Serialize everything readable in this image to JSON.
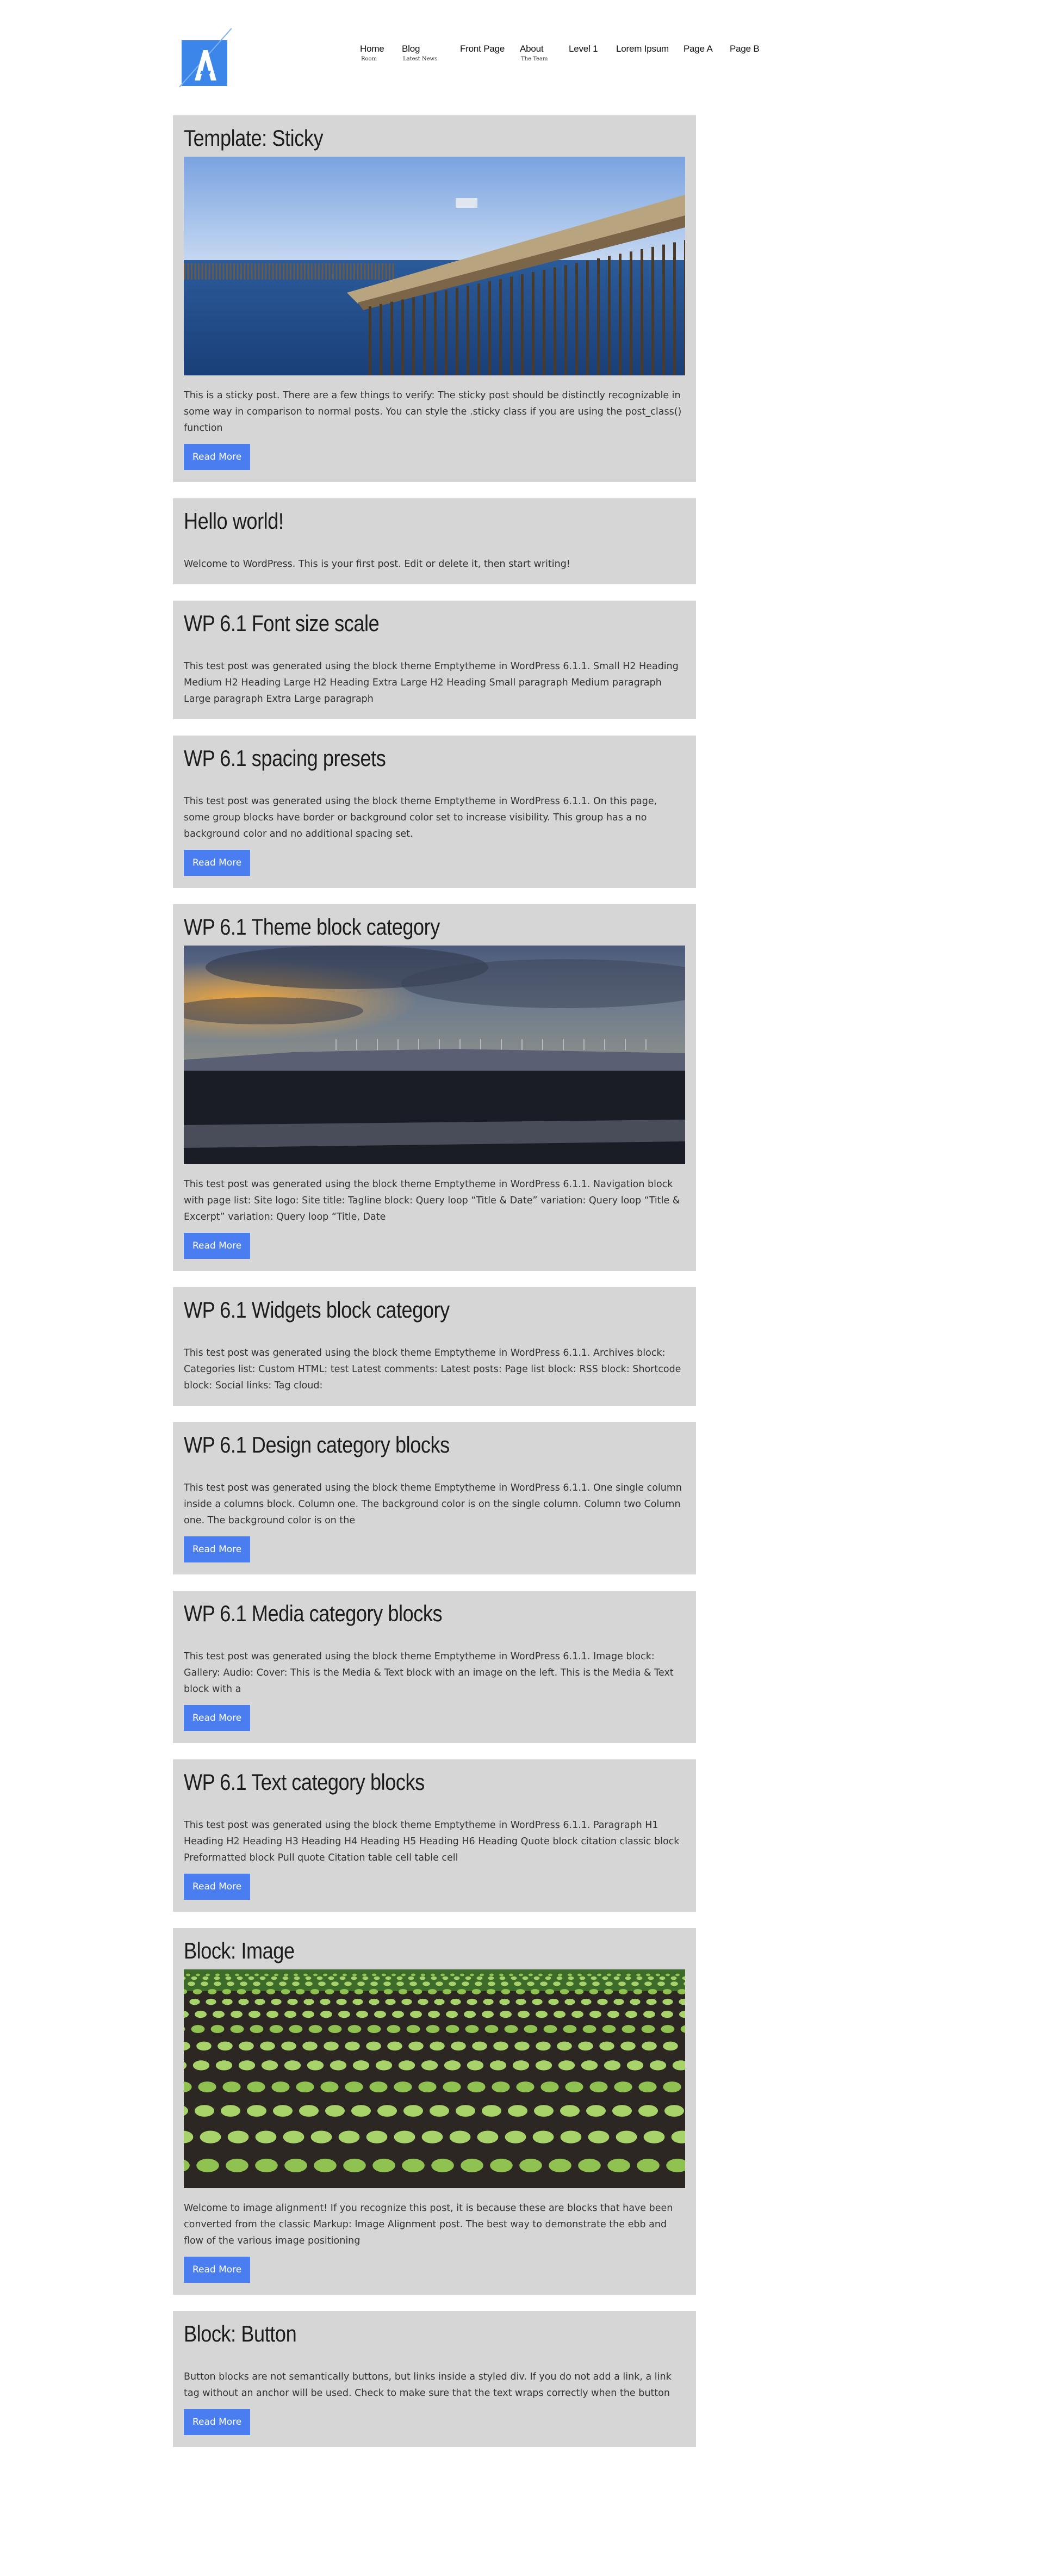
{
  "header": {
    "nav": [
      {
        "label": "Home",
        "desc": "Room",
        "width": 77
      },
      {
        "label": "Blog",
        "desc": "Latest News",
        "width": 107
      },
      {
        "label": "Front Page",
        "desc": "",
        "width": 110
      },
      {
        "label": "About",
        "desc": "The Team",
        "width": 90
      },
      {
        "label": "Level 1",
        "desc": "",
        "width": 87
      },
      {
        "label": "Lorem Ipsum",
        "desc": "",
        "width": 124
      },
      {
        "label": "Page A",
        "desc": "",
        "width": 85
      },
      {
        "label": "Page B",
        "desc": "",
        "width": 60
      }
    ]
  },
  "read_more_label": "Read More",
  "posts": [
    {
      "title": "Template: Sticky",
      "image": "pier",
      "excerpt": "This is a sticky post. There are a few things to verify: The sticky post should be distinctly recognizable in some way in comparison to normal posts. You can style the .sticky class if you are using the post_class() function",
      "read_more": true
    },
    {
      "title": "Hello world!",
      "image": "",
      "excerpt": "Welcome to WordPress. This is your first post. Edit or delete it, then start writing!",
      "read_more": false
    },
    {
      "title": "WP 6.1 Font size scale",
      "image": "",
      "excerpt": "This test post was generated using the block theme Emptytheme in WordPress 6.1.1. Small H2 Heading Medium H2 Heading Large H2 Heading Extra Large H2 Heading Small paragraph Medium paragraph Large paragraph Extra Large paragraph",
      "read_more": false
    },
    {
      "title": "WP 6.1 spacing presets",
      "image": "",
      "excerpt": "This test post was generated using the block theme Emptytheme in WordPress 6.1.1. On this page, some group blocks have border or background color set to increase visibility. This group has a no background color and no additional spacing set.",
      "read_more": true
    },
    {
      "title": "WP 6.1 Theme block category",
      "image": "sunset",
      "excerpt": "This test post was generated using the block theme Emptytheme in WordPress 6.1.1. Navigation block with page list: Site logo: Site title: Tagline block: Query loop “Title & Date” variation: Query loop “Title & Excerpt” variation: Query loop “Title, Date",
      "read_more": true
    },
    {
      "title": "WP 6.1 Widgets block category",
      "image": "",
      "excerpt": "This test post was generated using the block theme Emptytheme in WordPress 6.1.1. Archives block: Categories list: Custom HTML: test Latest comments: Latest posts: Page list block: RSS block: Shortcode block: Social links: Tag cloud:",
      "read_more": false
    },
    {
      "title": "WP 6.1 Design category blocks",
      "image": "",
      "excerpt": "This test post was generated using the block theme Emptytheme in WordPress 6.1.1. One single column inside a columns block. Column one. The background color is on the single column. Column two Column one. The background color is on the",
      "read_more": true
    },
    {
      "title": "WP 6.1 Media category blocks",
      "image": "",
      "excerpt": "This test post was generated using the block theme Emptytheme in WordPress 6.1.1. Image block: Gallery: Audio: Cover: This is the Media & Text block with an image on the left. This is the Media & Text block with a",
      "read_more": true
    },
    {
      "title": "WP 6.1 Text category blocks",
      "image": "",
      "excerpt": "This test post was generated using the block theme Emptytheme in WordPress 6.1.1. Paragraph H1 Heading H2 Heading H3 Heading H4 Heading H5 Heading H6 Heading Quote block citation classic block Preformatted block Pull quote Citation table cell table cell",
      "read_more": true
    },
    {
      "title": "Block: Image",
      "image": "field",
      "excerpt": "Welcome to image alignment! If you recognize this post, it is because these are blocks that have been converted from the classic Markup: Image Alignment post. The best way to demonstrate the ebb and flow of the various image positioning",
      "read_more": true
    },
    {
      "title": "Block: Button",
      "image": "",
      "excerpt": "Button blocks are not semantically buttons, but links inside a styled div.  If you do not add a link, a link tag without an anchor will be used. Check to make sure that the text wraps correctly when the button",
      "read_more": true
    }
  ],
  "colors": {
    "post_bg": "#d6d6d6",
    "button_bg": "#4a7df0",
    "logo_blue": "#3b86e8"
  }
}
